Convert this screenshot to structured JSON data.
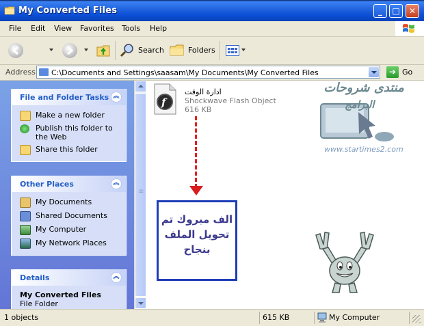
{
  "window": {
    "title": "My Converted Files"
  },
  "menu": [
    "File",
    "Edit",
    "View",
    "Favorites",
    "Tools",
    "Help"
  ],
  "toolbar": {
    "search_label": "Search",
    "folders_label": "Folders"
  },
  "address": {
    "label": "Address",
    "path": "C:\\Documents and Settings\\saasam\\My Documents\\My Converted Files",
    "go_label": "Go"
  },
  "tasks": {
    "file_folder": {
      "title": "File and Folder Tasks",
      "items": [
        "Make a new folder",
        "Publish this folder to the Web",
        "Share this folder"
      ]
    },
    "other_places": {
      "title": "Other Places",
      "items": [
        "My Documents",
        "Shared Documents",
        "My Computer",
        "My Network Places"
      ]
    },
    "details": {
      "title": "Details",
      "name": "My Converted Files",
      "type": "File Folder"
    }
  },
  "file": {
    "name": "ادارة الوقت",
    "type": "Shockwave Flash Object",
    "size": "616 KB"
  },
  "overlay": {
    "message_line1": "الف مبروك تم",
    "message_line2": "تحويل الملف",
    "message_line3": "بنجاح",
    "watermark_line1": "منتدى شروحات",
    "watermark_line2": "البرامج",
    "watermark_url": "www.startimes2.com"
  },
  "status": {
    "objects": "1 objects",
    "size": "615 KB",
    "location": "My Computer"
  },
  "colors": {
    "title_blue": "#0843B9",
    "task_pane": "#6375D6",
    "arrow_red": "#D81E1E",
    "message_border": "#1E3CB8"
  }
}
